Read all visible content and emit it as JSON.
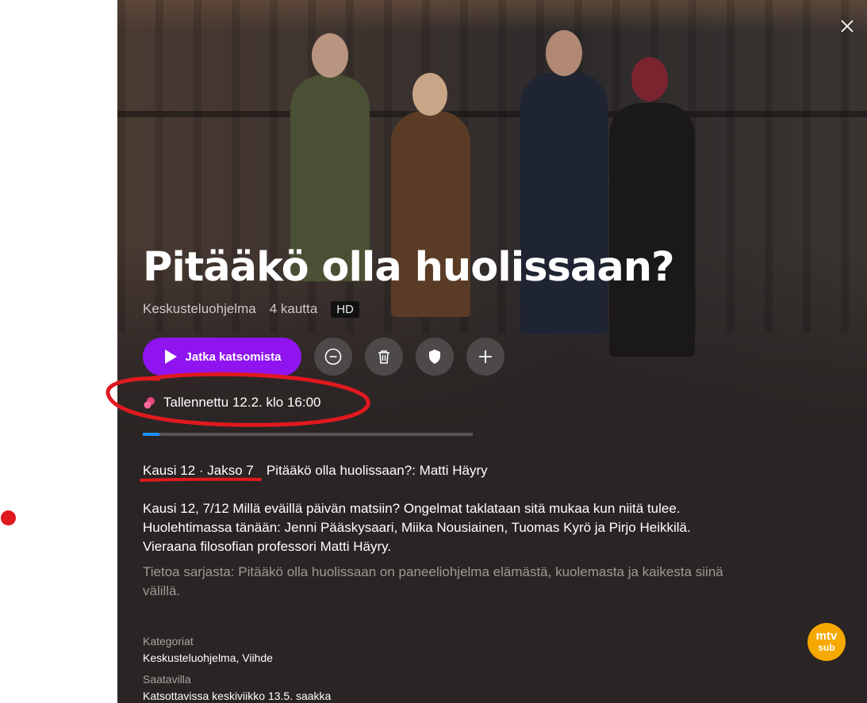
{
  "show": {
    "title": "Pitääkö olla huolissaan?",
    "genre": "Keskusteluohjelma",
    "channel": "4 kautta",
    "quality_badge": "HD"
  },
  "actions": {
    "play_label": "Jatka katsomista",
    "icons": [
      "play-icon",
      "minus-circle-icon",
      "trash-icon",
      "shield-icon",
      "plus-icon"
    ]
  },
  "recording": {
    "status_text": "Tallennettu 12.2. klo 16:00",
    "icon": "recording-dot-icon",
    "watch_progress": 0.05
  },
  "episode": {
    "season_episode": "Kausi 12 · Jakso 7",
    "episode_title": "Pitääkö olla huolissaan?: Matti Häyry",
    "description": "Kausi 12, 7/12 Millä eväillä päivän matsiin? Ongelmat taklataan sitä mukaa kun niitä tulee. Huolehtimassa tänään: Jenni Pääskysaari, Miika Nousiainen, Tuomas Kyrö ja Pirjo Heikkilä. Vieraana filosofian professori Matti Häyry.",
    "series_info": "Tietoa sarjasta: Pitääkö olla huolissaan on paneeliohjelma elämästä, kuolemasta ja kaikesta siinä välillä."
  },
  "info": {
    "categories_label": "Kategoriat",
    "categories_value": "Keskusteluohjelma, Viihde",
    "availability_label": "Saatavilla",
    "availability_value": "Katsottavissa keskiviikko 13.5. saakka"
  },
  "logo": {
    "line1": "mtv",
    "line2": "sub"
  },
  "colors": {
    "panel_bg": "#2a2424",
    "accent_purple": "#8f14f0",
    "progress_blue": "#1e90ff",
    "annotation_red": "#e0191f",
    "logo_yellow": "#f5a800"
  }
}
